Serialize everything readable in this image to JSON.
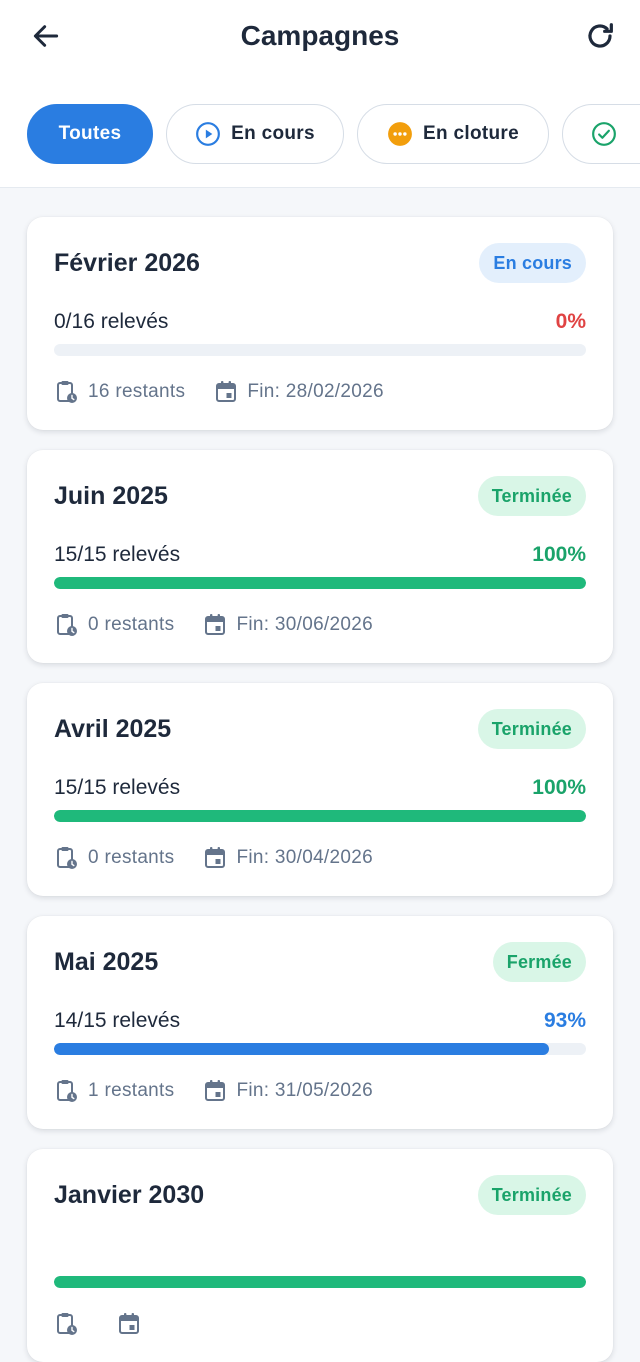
{
  "header": {
    "title": "Campagnes",
    "back_icon": "arrow-left-icon",
    "refresh_icon": "refresh-icon"
  },
  "filters": [
    {
      "label": "Toutes",
      "active": true,
      "icon": ""
    },
    {
      "label": "En cours",
      "active": false,
      "icon": "play-circle-icon",
      "icon_color": "#2a7de1"
    },
    {
      "label": "En cloture",
      "active": false,
      "icon": "more-circle-icon",
      "icon_color": "#f29e0c"
    },
    {
      "label": "",
      "active": false,
      "icon": "check-circle-icon",
      "icon_color": "#1aa36a"
    }
  ],
  "colors": {
    "primary": "#2a7de1",
    "success": "#1aa36a",
    "success_bar": "#1fb97b",
    "danger": "#e04343",
    "muted": "#64748b"
  },
  "campaigns": [
    {
      "title": "Février 2026",
      "status": "En cours",
      "status_style": "blue",
      "count": "0/16 relevés",
      "percent": "0%",
      "percent_color": "#e04343",
      "progress": 0,
      "bar_color": "#2a7de1",
      "remaining": "16 restants",
      "end": "Fin: 28/02/2026"
    },
    {
      "title": "Juin 2025",
      "status": "Terminée",
      "status_style": "green",
      "count": "15/15 relevés",
      "percent": "100%",
      "percent_color": "#1aa36a",
      "progress": 1,
      "bar_color": "#1fb97b",
      "remaining": "0 restants",
      "end": "Fin: 30/06/2026"
    },
    {
      "title": "Avril 2025",
      "status": "Terminée",
      "status_style": "green",
      "count": "15/15 relevés",
      "percent": "100%",
      "percent_color": "#1aa36a",
      "progress": 1,
      "bar_color": "#1fb97b",
      "remaining": "0 restants",
      "end": "Fin: 30/04/2026"
    },
    {
      "title": "Mai 2025",
      "status": "Fermée",
      "status_style": "green",
      "count": "14/15 relevés",
      "percent": "93%",
      "percent_color": "#2a7de1",
      "progress": 0.93,
      "bar_color": "#2a7de1",
      "remaining": "1 restants",
      "end": "Fin: 31/05/2026"
    },
    {
      "title": "Janvier 2030",
      "status": "Terminée",
      "status_style": "green",
      "count": "",
      "percent": "",
      "percent_color": "#1aa36a",
      "progress": 1,
      "bar_color": "#1fb97b",
      "remaining": "",
      "end": ""
    }
  ]
}
